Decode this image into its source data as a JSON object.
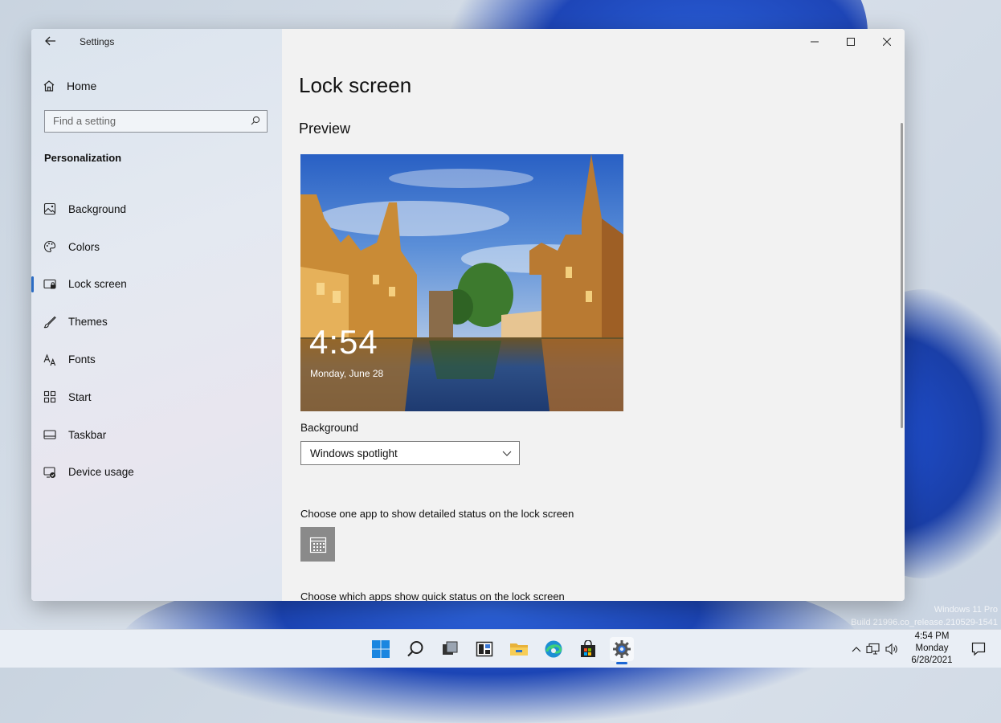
{
  "desktop": {
    "watermark": {
      "line1": "Windows 11 Pro",
      "line2": "Build 21996.co_release.210529-1541"
    }
  },
  "window": {
    "app_title": "Settings",
    "controls": {
      "minimize": "minimize-icon",
      "maximize": "maximize-icon",
      "close": "close-icon"
    }
  },
  "sidebar": {
    "home_label": "Home",
    "search": {
      "placeholder": "Find a setting",
      "value": ""
    },
    "section_heading": "Personalization",
    "items": [
      {
        "label": "Background",
        "icon": "image-icon",
        "active": false
      },
      {
        "label": "Colors",
        "icon": "palette-icon",
        "active": false
      },
      {
        "label": "Lock screen",
        "icon": "lock-screen-icon",
        "active": true
      },
      {
        "label": "Themes",
        "icon": "brush-icon",
        "active": false
      },
      {
        "label": "Fonts",
        "icon": "font-icon",
        "active": false
      },
      {
        "label": "Start",
        "icon": "start-grid-icon",
        "active": false
      },
      {
        "label": "Taskbar",
        "icon": "taskbar-icon",
        "active": false
      },
      {
        "label": "Device usage",
        "icon": "device-usage-icon",
        "active": false
      }
    ]
  },
  "main": {
    "title": "Lock screen",
    "preview_heading": "Preview",
    "preview": {
      "time": "4:54",
      "date": "Monday, June 28"
    },
    "background_label": "Background",
    "background_value": "Windows spotlight",
    "detailed_status_label": "Choose one app to show detailed status on the lock screen",
    "quick_status_label": "Choose which apps show quick status on the lock screen"
  },
  "taskbar": {
    "apps": [
      "start-icon",
      "search-icon",
      "task-view-icon",
      "widgets-icon",
      "file-explorer-icon",
      "edge-icon",
      "store-icon",
      "settings-icon"
    ],
    "tray": {
      "time": "4:54 PM",
      "day": "Monday",
      "date": "6/28/2021"
    }
  },
  "colors": {
    "accent": "#2b6cc4",
    "taskbar_indicator": "#1a66d4"
  }
}
